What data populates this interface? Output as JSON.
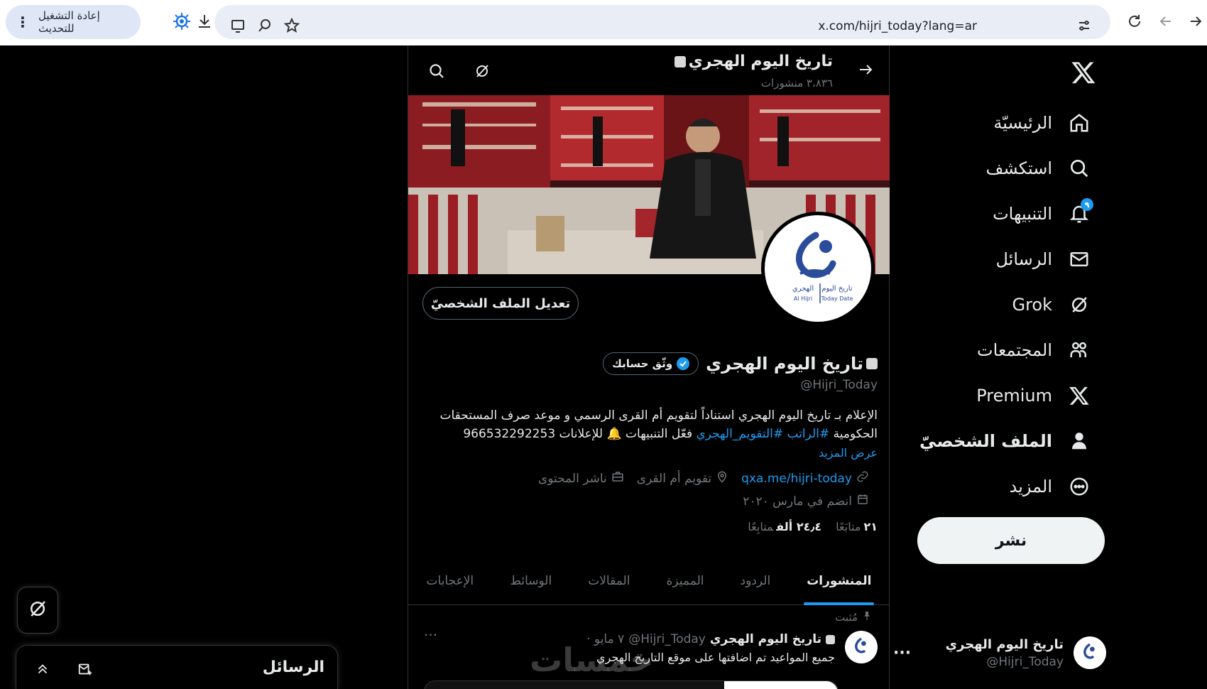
{
  "browser": {
    "restart_label": "إعادة التشغيل للتحديث",
    "url": "x.com/hijri_today?lang=ar"
  },
  "sidebar": {
    "items": [
      {
        "label": "الرئيسيّة",
        "icon": "home-icon"
      },
      {
        "label": "استكشف",
        "icon": "search-icon"
      },
      {
        "label": "التنبيهات",
        "icon": "bell-icon",
        "badge": "٩"
      },
      {
        "label": "الرسائل",
        "icon": "mail-icon"
      },
      {
        "label": "Grok",
        "icon": "grok-icon"
      },
      {
        "label": "المجتمعات",
        "icon": "communities-icon"
      },
      {
        "label": "Premium",
        "icon": "x-premium-icon"
      },
      {
        "label": "الملف الشخصيّ",
        "icon": "profile-icon"
      },
      {
        "label": "المزيد",
        "icon": "more-circle-icon"
      }
    ],
    "post_button": "نشر",
    "account": {
      "name": "تاريخ اليوم الهجري",
      "handle": "@Hijri_Today"
    }
  },
  "header": {
    "title": "تاريخ اليوم الهجري",
    "post_count": "٣،٨٣٦ منشورات"
  },
  "profile": {
    "edit_button": "تعديل الملف الشخصيّ",
    "name": "تاريخ اليوم الهجري",
    "verify_button": "وثّق حسابك",
    "handle": "@Hijri_Today",
    "bio_line1": "الإعلام بـ تاريخ اليوم الهجري استناداً لتقويم أم القرى الرسمي و موعد صرف المستحقات",
    "bio_line2_start": "الحكومية",
    "bio_hashtags": "#الراتب #التقويم_الهجري",
    "bio_line2_end": "فعّل التنبيهات 🔔 للإعلانات 966532292253",
    "show_more": "عرض المزيد",
    "category": "ناشر المحتوى",
    "location": "تقويم أم القرى",
    "website": "qxa.me/hijri-today",
    "joined": "انضم في مارس ٢٠٢٠",
    "following_count": "٢١",
    "following_label": "متابَعًا",
    "followers_count": "٢٤٫٤ ألف",
    "followers_label": "متابِعًا"
  },
  "tabs": [
    "المنشورات",
    "الردود",
    "المميزة",
    "المقالات",
    "الوسائط",
    "الإعجابات"
  ],
  "pinned_post": {
    "pinned_label": "مُثبت",
    "name": "تاريخ اليوم الهجري",
    "handle": "@Hijri_Today",
    "date": "· ٧ مايو",
    "text": "جميع المواعيد تم اضافتها على موقع التاريخ الهجري"
  },
  "avatar_logo": {
    "line1": "تاريخ اليوم",
    "line2": "الهجري",
    "en1": "Today Date",
    "en2": "Al Hijri"
  },
  "messages_drawer": {
    "title": "الرسائل"
  },
  "watermark": "خمسات",
  "colors": {
    "accent": "#1d9bf0",
    "background": "#000000",
    "text": "#e7e9ea",
    "muted": "#71767b"
  }
}
